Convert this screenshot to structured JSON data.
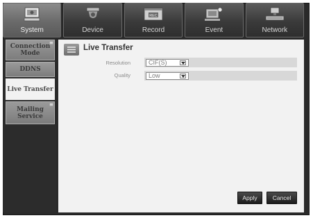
{
  "tabs": [
    {
      "label": "System",
      "icon": "system-icon",
      "active": true
    },
    {
      "label": "Device",
      "icon": "camera-icon",
      "active": false
    },
    {
      "label": "Record",
      "icon": "record-icon",
      "active": false
    },
    {
      "label": "Event",
      "icon": "event-icon",
      "active": false
    },
    {
      "label": "Network",
      "icon": "network-icon",
      "active": false
    }
  ],
  "sidebar": {
    "items": [
      {
        "label": "Connection Mode"
      },
      {
        "label": "DDNS"
      },
      {
        "label": "Live Transfer"
      },
      {
        "label": "Mailing Service"
      }
    ]
  },
  "panel": {
    "title": "Live Transfer",
    "resolution": {
      "label": "Resolution",
      "value": "CIF(S)"
    },
    "quality": {
      "label": "Quality",
      "value": "Low"
    }
  },
  "buttons": {
    "apply": "Apply",
    "cancel": "Cancel"
  }
}
